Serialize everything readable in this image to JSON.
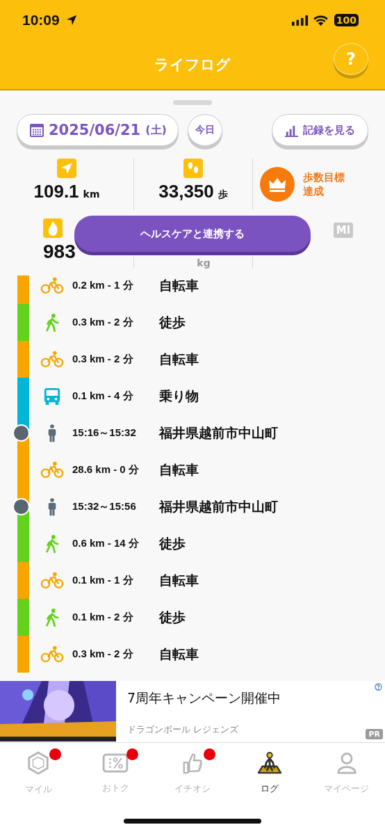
{
  "status_bar": {
    "time": "10:09",
    "battery": "100"
  },
  "header": {
    "title": "ライフログ",
    "help_label": "?"
  },
  "toolbar": {
    "date": "2025/06/21",
    "weekday": "(土)",
    "today_label": "今日",
    "records_label": "記録を見る"
  },
  "stats": [
    {
      "kind": "distance",
      "value": "109.1",
      "unit": "km"
    },
    {
      "kind": "steps",
      "value": "33,350",
      "unit": "歩"
    },
    {
      "kind": "goal",
      "lines": [
        "歩数目標",
        "達成"
      ]
    }
  ],
  "stats_row2": [
    {
      "kind": "calories",
      "value": "983"
    },
    {
      "kind": "weight",
      "unit": "kg"
    },
    {
      "kind": "bmi",
      "badge": "MI"
    }
  ],
  "healthcare_button": "ヘルスケアと連携する",
  "timeline": [
    {
      "kind": "bike",
      "detail": "0.2 km - 1 分",
      "label": "自転車"
    },
    {
      "kind": "walk",
      "detail": "0.3 km - 2 分",
      "label": "徒歩"
    },
    {
      "kind": "bike",
      "detail": "0.3 km - 2 分",
      "label": "自転車"
    },
    {
      "kind": "vehicle",
      "detail": "0.1 km - 4 分",
      "label": "乗り物"
    },
    {
      "kind": "stay",
      "detail": "15:16～15:32",
      "label": "福井県越前市中山町"
    },
    {
      "kind": "bike",
      "detail": "28.6 km - 0 分",
      "label": "自転車"
    },
    {
      "kind": "stay",
      "detail": "15:32～15:56",
      "label": "福井県越前市中山町"
    },
    {
      "kind": "walk",
      "detail": "0.6 km - 14 分",
      "label": "徒歩"
    },
    {
      "kind": "bike",
      "detail": "0.1 km - 1 分",
      "label": "自転車"
    },
    {
      "kind": "walk",
      "detail": "0.1 km - 2 分",
      "label": "徒歩"
    },
    {
      "kind": "bike",
      "detail": "0.3 km - 2 分",
      "label": "自転車"
    }
  ],
  "ad": {
    "title": "7周年キャンペーン開催中",
    "advertiser": "ドラゴンボール レジェンズ",
    "badge": "PR"
  },
  "tabs": [
    {
      "kind": "mile",
      "label": "マイル",
      "selected": false,
      "badge": true
    },
    {
      "kind": "deal",
      "label": "おトク",
      "selected": false,
      "badge": true
    },
    {
      "kind": "pick",
      "label": "イチオシ",
      "selected": false,
      "badge": true
    },
    {
      "kind": "log",
      "label": "ログ",
      "selected": true,
      "badge": false
    },
    {
      "kind": "mypage",
      "label": "マイページ",
      "selected": false,
      "badge": false
    }
  ]
}
